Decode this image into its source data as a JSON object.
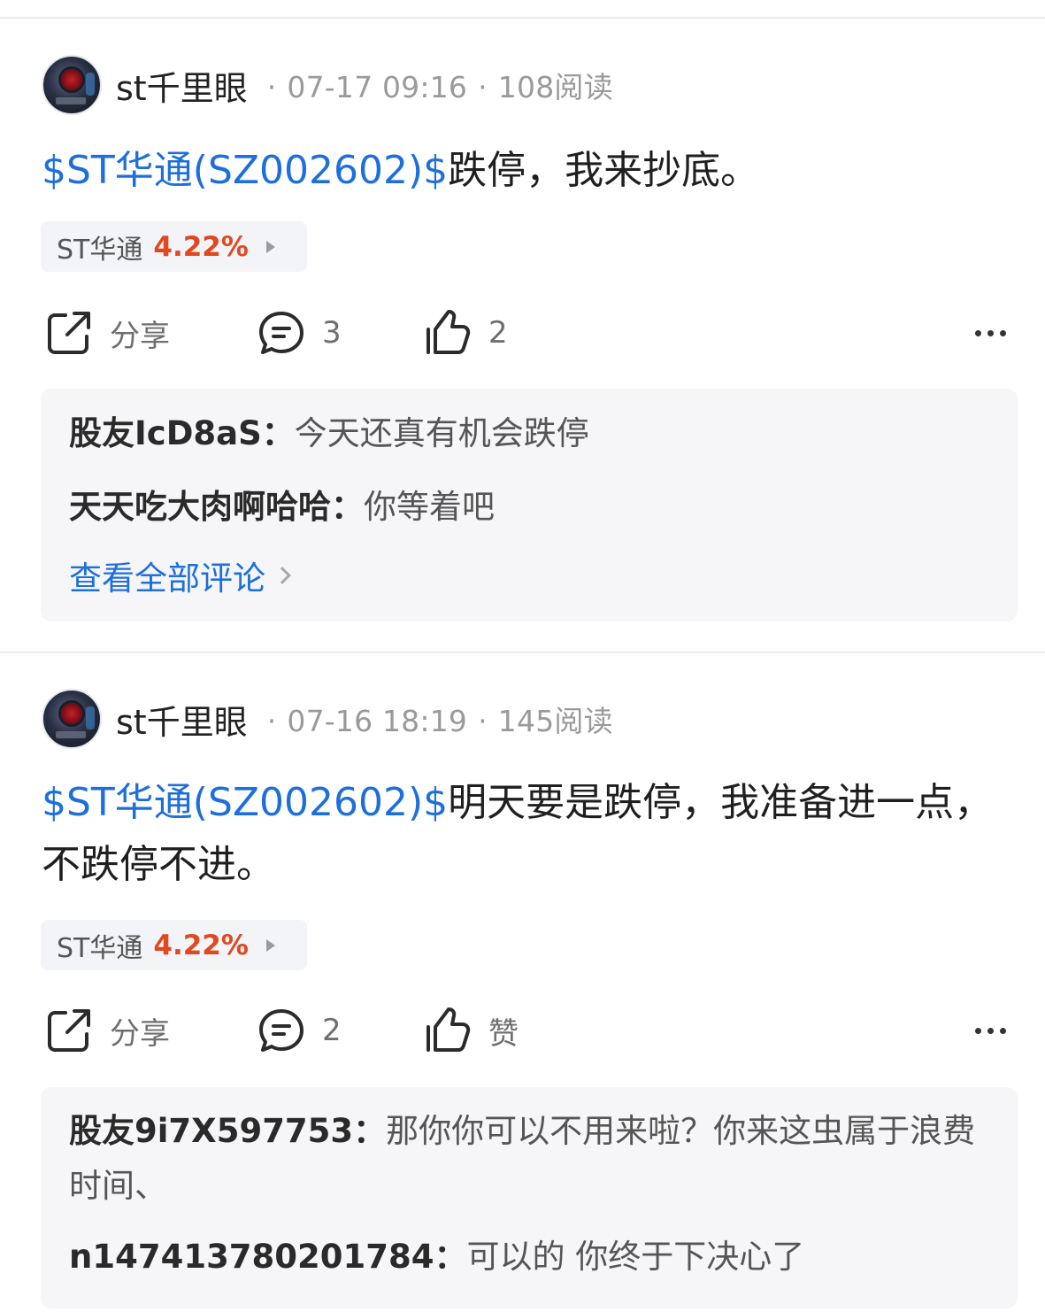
{
  "posts": [
    {
      "author": "st千里眼",
      "time": "07-17 09:16",
      "reads": "108阅读",
      "stock_link": "$ST华通(SZ002602)$",
      "text": "跌停，我来抄底。",
      "chip": {
        "name": "ST华通",
        "change": "4.22%"
      },
      "actions": {
        "share": "分享",
        "comments": "3",
        "likes": "2"
      },
      "comments": [
        {
          "user": "股友IcD8aS",
          "text": "今天还真有机会跌停"
        },
        {
          "user": "天天吃大肉啊哈哈",
          "text": "你等着吧"
        }
      ],
      "view_all": "查看全部评论"
    },
    {
      "author": "st千里眼",
      "time": "07-16 18:19",
      "reads": "145阅读",
      "stock_link": "$ST华通(SZ002602)$",
      "text": "明天要是跌停，我准备进一点，不跌停不进。",
      "chip": {
        "name": "ST华通",
        "change": "4.22%"
      },
      "actions": {
        "share": "分享",
        "comments": "2",
        "likes": "赞"
      },
      "comments": [
        {
          "user": "股友9i7X597753",
          "text": "那你你可以不用来啦？你来这虫属于浪费时间、"
        },
        {
          "user": "n147413780201784",
          "text": "可以的 你终于下决心了"
        }
      ]
    }
  ],
  "colors": {
    "link": "#1e6fdc",
    "up": "#e2481f"
  },
  "icons": [
    "share-icon",
    "comment-icon",
    "like-icon",
    "more-icon",
    "chevron-right-icon"
  ]
}
